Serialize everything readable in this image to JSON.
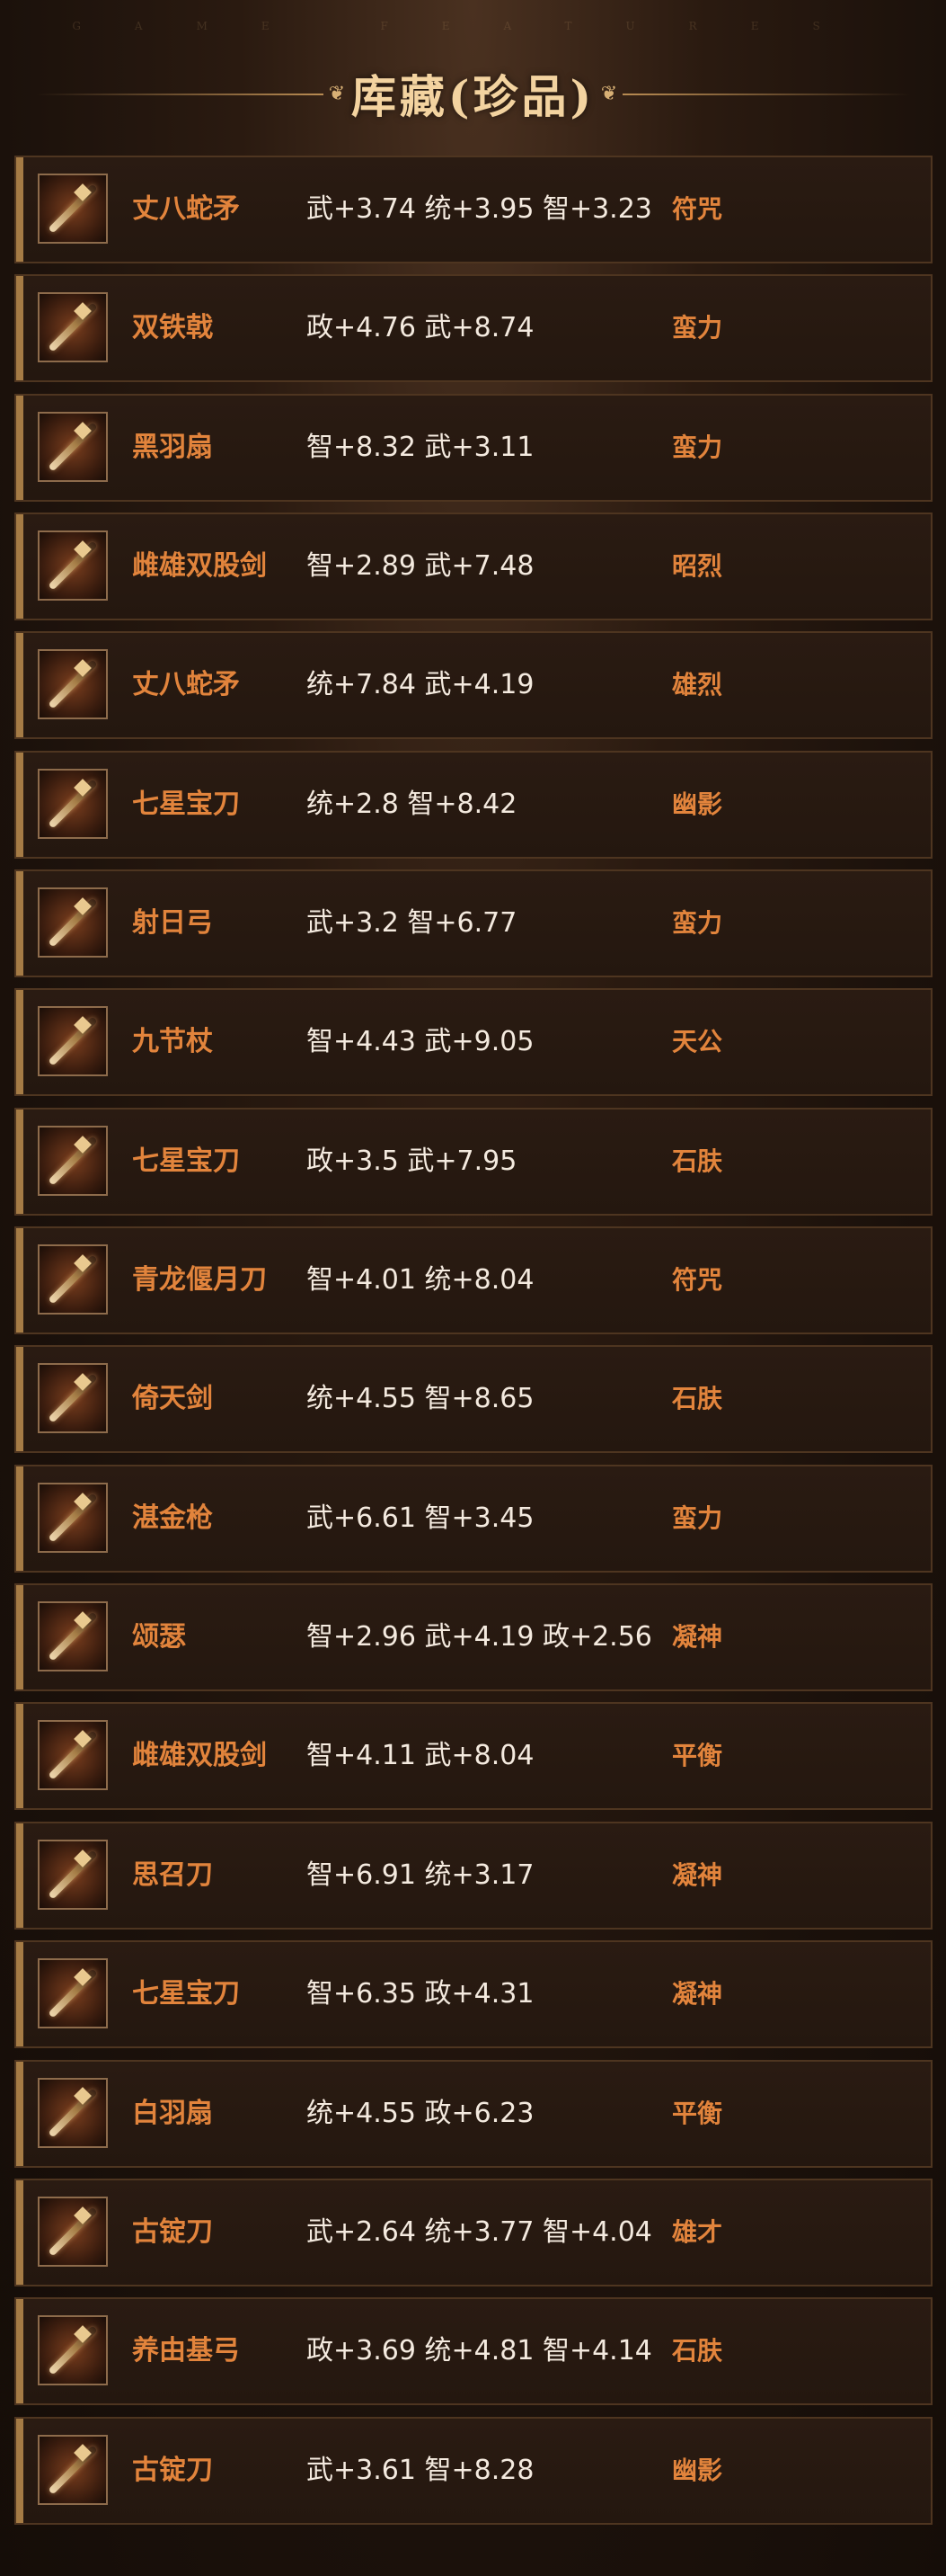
{
  "header": {
    "faint_text": "GAME FEATURES",
    "title": "库藏(珍品)",
    "accent_color": "#f3d3a0"
  },
  "colors": {
    "name": "#e2843c",
    "stats": "#f4eadf",
    "trait": "#e2843c",
    "row_bg": "#24170f",
    "row_border": "#4e3520"
  },
  "items": [
    {
      "name": "丈八蛇矛",
      "stats": "武+3.74 统+3.95 智+3.23",
      "trait": "符咒",
      "icon": "spear-icon"
    },
    {
      "name": "双铁戟",
      "stats": "政+4.76 武+8.74",
      "trait": "蛮力",
      "icon": "halberd-icon"
    },
    {
      "name": "黑羽扇",
      "stats": "智+8.32 武+3.11",
      "trait": "蛮力",
      "icon": "fan-icon"
    },
    {
      "name": "雌雄双股剑",
      "stats": "智+2.89 武+7.48",
      "trait": "昭烈",
      "icon": "twin-swords-icon"
    },
    {
      "name": "丈八蛇矛",
      "stats": "统+7.84 武+4.19",
      "trait": "雄烈",
      "icon": "spear-icon"
    },
    {
      "name": "七星宝刀",
      "stats": "统+2.8 智+8.42",
      "trait": "幽影",
      "icon": "blade-icon"
    },
    {
      "name": "射日弓",
      "stats": "武+3.2 智+6.77",
      "trait": "蛮力",
      "icon": "bow-icon"
    },
    {
      "name": "九节杖",
      "stats": "智+4.43 武+9.05",
      "trait": "天公",
      "icon": "staff-icon"
    },
    {
      "name": "七星宝刀",
      "stats": "政+3.5 武+7.95",
      "trait": "石肤",
      "icon": "blade-icon"
    },
    {
      "name": "青龙偃月刀",
      "stats": "智+4.01 统+8.04",
      "trait": "符咒",
      "icon": "glaive-icon"
    },
    {
      "name": "倚天剑",
      "stats": "统+4.55 智+8.65",
      "trait": "石肤",
      "icon": "sword-icon"
    },
    {
      "name": "湛金枪",
      "stats": "武+6.61 智+3.45",
      "trait": "蛮力",
      "icon": "spear-icon"
    },
    {
      "name": "颂瑟",
      "stats": "智+2.96 武+4.19 政+2.56",
      "trait": "凝神",
      "icon": "zither-icon"
    },
    {
      "name": "雌雄双股剑",
      "stats": "智+4.11 武+8.04",
      "trait": "平衡",
      "icon": "twin-swords-icon"
    },
    {
      "name": "思召刀",
      "stats": "智+6.91 统+3.17",
      "trait": "凝神",
      "icon": "blade-icon"
    },
    {
      "name": "七星宝刀",
      "stats": "智+6.35 政+4.31",
      "trait": "凝神",
      "icon": "blade-icon"
    },
    {
      "name": "白羽扇",
      "stats": "统+4.55 政+6.23",
      "trait": "平衡",
      "icon": "fan-icon"
    },
    {
      "name": "古锭刀",
      "stats": "武+2.64 统+3.77 智+4.04",
      "trait": "雄才",
      "icon": "blade-icon"
    },
    {
      "name": "养由基弓",
      "stats": "政+3.69 统+4.81 智+4.14",
      "trait": "石肤",
      "icon": "bow-icon"
    },
    {
      "name": "古锭刀",
      "stats": "武+3.61 智+8.28",
      "trait": "幽影",
      "icon": "blade-icon"
    }
  ]
}
